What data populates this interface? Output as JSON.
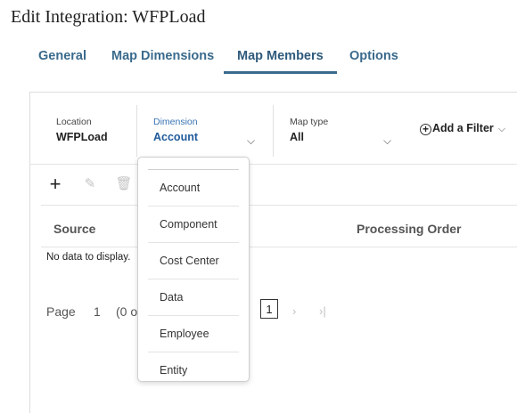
{
  "page": {
    "title": "Edit Integration: WFPLoad"
  },
  "tabs": [
    {
      "label": "General"
    },
    {
      "label": "Map Dimensions"
    },
    {
      "label": "Map Members"
    },
    {
      "label": "Options"
    }
  ],
  "filters": {
    "location": {
      "label": "Location",
      "value": "WFPLoad"
    },
    "dimension": {
      "label": "Dimension",
      "value": "Account"
    },
    "map_type": {
      "label": "Map type",
      "value": "All"
    },
    "add_filter": "Add a Filter"
  },
  "toolbar": {
    "add_icon": "plus-icon",
    "edit_icon": "pencil-icon",
    "delete_icon": "trash-icon"
  },
  "table": {
    "columns": [
      "Source",
      "Processing Order"
    ],
    "empty_message": "No data to display."
  },
  "pager": {
    "page_label": "Page",
    "current": "1",
    "of_text": "(0 o",
    "page_box": "1",
    "next": "›",
    "last": "›|"
  },
  "dimension_dropdown": {
    "options": [
      "Account",
      "Component",
      "Cost Center",
      "Data",
      "Employee",
      "Entity"
    ]
  },
  "colors": {
    "accent": "#3a6a8c",
    "link": "#1f5a9a"
  }
}
